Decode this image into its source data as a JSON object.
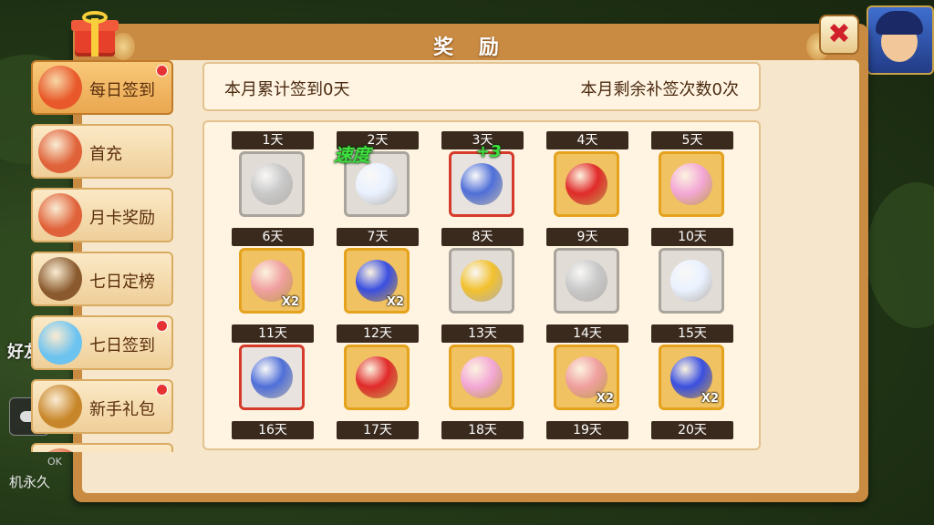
{
  "window": {
    "title": "奖 励",
    "close_label": "✖"
  },
  "sidebar": {
    "items": [
      {
        "label": "每日签到",
        "icon": "lucky-bag-icon",
        "active": true,
        "dot": true
      },
      {
        "label": "首充",
        "icon": "money-bag-icon",
        "active": false,
        "dot": false
      },
      {
        "label": "月卡奖励",
        "icon": "money-bag-icon",
        "active": false,
        "dot": false
      },
      {
        "label": "七日定榜",
        "icon": "rank-chest-icon",
        "active": false,
        "dot": false
      },
      {
        "label": "七日签到",
        "icon": "blue-bag-icon",
        "active": false,
        "dot": true
      },
      {
        "label": "新手礼包",
        "icon": "treasure-icon",
        "active": false,
        "dot": true
      },
      {
        "label": "",
        "icon": "money-bag-icon",
        "active": false,
        "dot": false
      }
    ]
  },
  "info": {
    "signed": "本月累计签到0天",
    "makeup": "本月剩余补签次数0次"
  },
  "floating": {
    "speed_text": "速度",
    "speed_plus": "+3"
  },
  "hud": {
    "friend": "好友",
    "ok": "OK",
    "bottom_text": "机永久"
  },
  "rewards": [
    {
      "day": "1天",
      "frame": "silver",
      "icon": "silver-coin-icon",
      "color": "#c9c9c9",
      "qty": ""
    },
    {
      "day": "2天",
      "frame": "silver",
      "icon": "dandelion-icon",
      "color": "#eaf2ff",
      "qty": ""
    },
    {
      "day": "3天",
      "frame": "red",
      "icon": "blue-armor-icon",
      "color": "#4f6fd8",
      "qty": ""
    },
    {
      "day": "4天",
      "frame": "gold",
      "icon": "red-gem-icon",
      "color": "#e12a2a",
      "qty": ""
    },
    {
      "day": "5天",
      "frame": "gold",
      "icon": "pink-egg-icon",
      "color": "#f3a8d6",
      "qty": ""
    },
    {
      "day": "6天",
      "frame": "gold",
      "icon": "pet-pig-icon",
      "color": "#f0a0a0",
      "qty": "X2"
    },
    {
      "day": "7天",
      "frame": "gold",
      "icon": "blue-orb-icon",
      "color": "#3a4fe0",
      "qty": "X2"
    },
    {
      "day": "8天",
      "frame": "silver",
      "icon": "gold-coin-icon",
      "color": "#f2c12e",
      "qty": ""
    },
    {
      "day": "9天",
      "frame": "silver",
      "icon": "silver-coin-icon",
      "color": "#c9c9c9",
      "qty": ""
    },
    {
      "day": "10天",
      "frame": "silver",
      "icon": "dandelion-icon",
      "color": "#eaf2ff",
      "qty": ""
    },
    {
      "day": "11天",
      "frame": "red",
      "icon": "blue-armor-icon",
      "color": "#4f6fd8",
      "qty": ""
    },
    {
      "day": "12天",
      "frame": "gold",
      "icon": "red-gem-icon",
      "color": "#e12a2a",
      "qty": ""
    },
    {
      "day": "13天",
      "frame": "gold",
      "icon": "pink-egg-icon",
      "color": "#f3a8d6",
      "qty": ""
    },
    {
      "day": "14天",
      "frame": "gold",
      "icon": "pet-pig-icon",
      "color": "#f0a0a0",
      "qty": "X2"
    },
    {
      "day": "15天",
      "frame": "gold",
      "icon": "blue-orb-icon",
      "color": "#3a4fe0",
      "qty": "X2"
    },
    {
      "day": "16天",
      "frame": "silver",
      "icon": "",
      "color": "",
      "qty": ""
    },
    {
      "day": "17天",
      "frame": "silver",
      "icon": "",
      "color": "",
      "qty": ""
    },
    {
      "day": "18天",
      "frame": "silver",
      "icon": "",
      "color": "",
      "qty": ""
    },
    {
      "day": "19天",
      "frame": "silver",
      "icon": "",
      "color": "",
      "qty": ""
    },
    {
      "day": "20天",
      "frame": "silver",
      "icon": "",
      "color": "",
      "qty": ""
    }
  ]
}
